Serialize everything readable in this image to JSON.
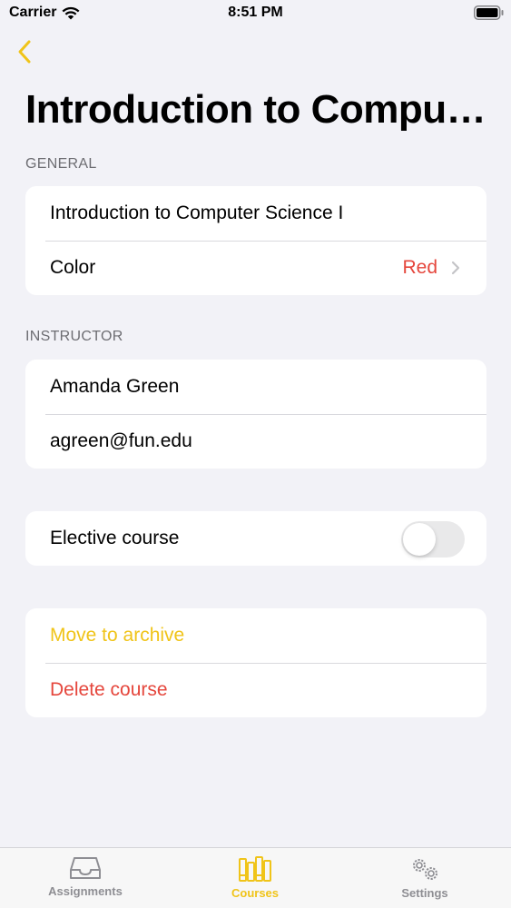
{
  "status_bar": {
    "carrier": "Carrier",
    "time": "8:51 PM"
  },
  "nav": {
    "title": "Introduction to Computer Science I"
  },
  "general": {
    "header": "GENERAL",
    "course_name": "Introduction to Computer Science I",
    "color_label": "Color",
    "color_value": "Red"
  },
  "instructor": {
    "header": "INSTRUCTOR",
    "name": "Amanda Green",
    "email": "agreen@fun.edu"
  },
  "elective": {
    "label": "Elective course",
    "enabled": false
  },
  "actions": {
    "archive": "Move to archive",
    "delete": "Delete course"
  },
  "tabs": [
    {
      "label": "Assignments",
      "icon": "tray-icon",
      "active": false
    },
    {
      "label": "Courses",
      "icon": "books-icon",
      "active": true
    },
    {
      "label": "Settings",
      "icon": "gears-icon",
      "active": false
    }
  ],
  "colors": {
    "accent": "#f0c419",
    "destructive": "#e5463c",
    "background": "#f2f2f7"
  }
}
